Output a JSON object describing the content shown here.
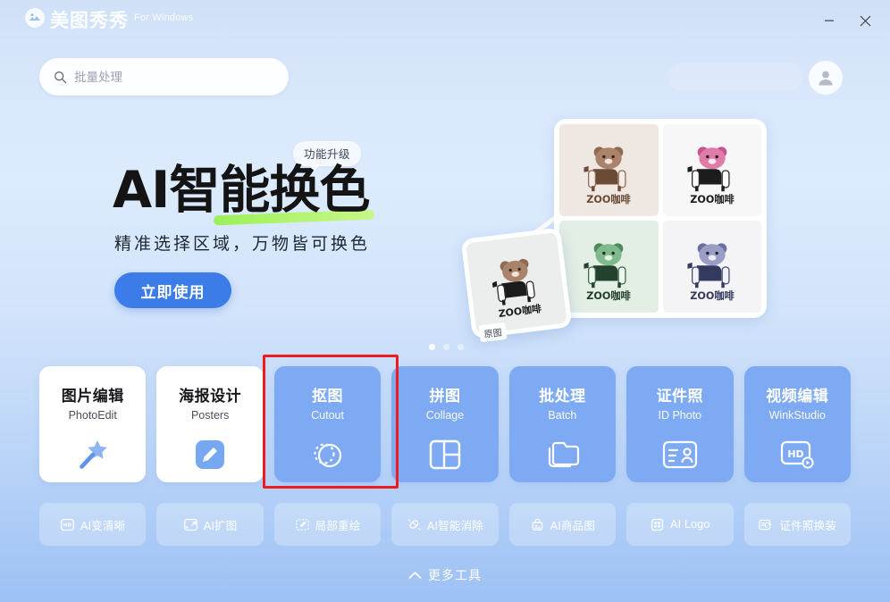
{
  "window": {
    "brand_name": "美图秀秀",
    "brand_sub": "For Windows",
    "minimize_label": "—",
    "close_label": "✕"
  },
  "search": {
    "placeholder": "批量处理",
    "value": "",
    "icon": "search-icon"
  },
  "account": {
    "avatar_icon": "user-avatar-icon"
  },
  "hero": {
    "badge": "功能升级",
    "title": "AI智能换色",
    "subtitle": "精准选择区域，万物皆可换色",
    "cta_label": "立即使用",
    "promo": {
      "original_tag": "原图",
      "brand_text": "ZOO咖啡",
      "cells": [
        {
          "name": "bear-brown",
          "bg": "#efe7e1",
          "fg": "#8e6b52"
        },
        {
          "name": "bear-pink",
          "bg": "#f7f7f8",
          "fg": "#c4548c"
        },
        {
          "name": "bear-green",
          "bg": "#e3eee4",
          "fg": "#5e9a6e"
        },
        {
          "name": "bear-purple",
          "bg": "#f4f4f7",
          "fg": "#7a7fae"
        }
      ]
    },
    "carousel": {
      "count": 3,
      "active": 0
    }
  },
  "cards": [
    {
      "title": "图片编辑",
      "sub": "PhotoEdit",
      "icon": "magic-wand-icon",
      "style": "light",
      "name": "photo-edit"
    },
    {
      "title": "海报设计",
      "sub": "Posters",
      "icon": "pencil-square-icon",
      "style": "light",
      "name": "posters"
    },
    {
      "title": "抠图",
      "sub": "Cutout",
      "icon": "cutout-circle-icon",
      "style": "blue",
      "name": "cutout",
      "highlighted": true
    },
    {
      "title": "拼图",
      "sub": "Collage",
      "icon": "collage-grid-icon",
      "style": "blue",
      "name": "collage"
    },
    {
      "title": "批处理",
      "sub": "Batch",
      "icon": "folder-stack-icon",
      "style": "blue",
      "name": "batch"
    },
    {
      "title": "证件照",
      "sub": "ID Photo",
      "icon": "id-card-icon",
      "style": "blue",
      "name": "id-photo"
    },
    {
      "title": "视频编辑",
      "sub": "WinkStudio",
      "icon": "hd-video-icon",
      "style": "blue",
      "name": "video-edit"
    }
  ],
  "tools": [
    {
      "label": "AI变清晰",
      "icon": "hd-enhance-icon",
      "name": "ai-enhance"
    },
    {
      "label": "AI扩图",
      "icon": "expand-image-icon",
      "name": "ai-expand"
    },
    {
      "label": "局部重绘",
      "icon": "repaint-icon",
      "name": "local-repaint"
    },
    {
      "label": "AI智能消除",
      "icon": "eraser-icon",
      "name": "ai-remove"
    },
    {
      "label": "AI商品图",
      "icon": "product-image-icon",
      "name": "ai-product"
    },
    {
      "label": "AI Logo",
      "icon": "logo-grid-icon",
      "name": "ai-logo"
    },
    {
      "label": "证件照换装",
      "icon": "outfit-change-icon",
      "name": "id-outfit"
    }
  ],
  "footer": {
    "more_label": "更多工具",
    "more_icon": "chevron-up-icon"
  },
  "colors": {
    "accent": "#3b7ce8",
    "card_blue": "#7daaf2",
    "highlight": "#ee1c1c",
    "underline": "#9bf05a"
  }
}
